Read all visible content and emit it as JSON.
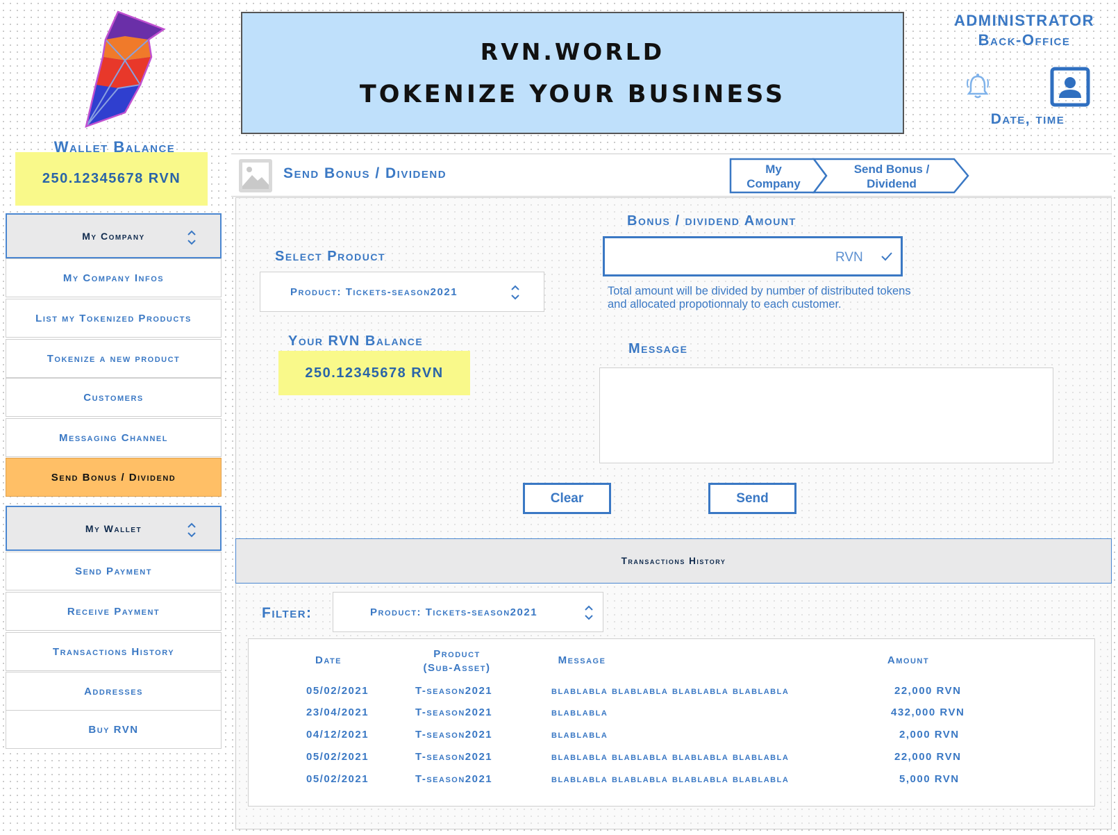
{
  "header": {
    "title_line1": "RVN.WORLD",
    "title_line2": "TOKENIZE YOUR BUSINESS",
    "admin_line1": "ADMINISTRATOR",
    "admin_line2": "Back-Office",
    "date_time": "Date, time",
    "icons": {
      "bell": "bell-icon",
      "avatar": "user-profile-icon"
    }
  },
  "wallet": {
    "label": "Wallet Balance",
    "balance": "250.12345678 RVN"
  },
  "sidebar": {
    "company_group": "My Company",
    "company_items": [
      "My Company Infos",
      "List my Tokenized Products",
      "Tokenize a new product",
      "Customers",
      "Messaging Channel",
      "Send Bonus / Dividend"
    ],
    "active_item": "Send Bonus / Dividend",
    "wallet_group": "My Wallet",
    "wallet_items": [
      "Send Payment",
      "Receive Payment",
      "Transactions History",
      "Addresses",
      "Buy RVN"
    ]
  },
  "page": {
    "title": "Send Bonus / Dividend",
    "breadcrumb": [
      "My Company",
      "Send Bonus / Dividend"
    ]
  },
  "form": {
    "amount_label": "Bonus / dividend Amount",
    "amount_value": "",
    "amount_unit": "RVN",
    "amount_help": "Total amount will be divided by number of distributed tokens and allocated propotionnaly to each customer.",
    "product_label": "Select Product",
    "product_value": "Product: Tickets-season2021",
    "rvn_balance_label": "Your RVN Balance",
    "rvn_balance_value": "250.12345678 RVN",
    "message_label": "Message",
    "message_value": "",
    "clear_label": "Clear",
    "send_label": "Send"
  },
  "history": {
    "header": "Transactions History",
    "filter_label": "Filter:",
    "filter_value": "Product: Tickets-season2021",
    "columns": [
      "Date",
      "Product\n(Sub-Asset)",
      "Message",
      "Amount"
    ],
    "rows": [
      [
        "05/02/2021",
        "T-season2021",
        "blablabla blablabla blablabla blablabla",
        "22,000 RVN"
      ],
      [
        "23/04/2021",
        "T-season2021",
        "blablabla",
        "432,000 RVN"
      ],
      [
        "04/12/2021",
        "T-season2021",
        "blablabla",
        "2,000 RVN"
      ],
      [
        "05/02/2021",
        "T-season2021",
        "blablabla blablabla blablabla blablabla",
        "22,000 RVN"
      ],
      [
        "05/02/2021",
        "T-season2021",
        "blablabla blablabla blablabla blablabla",
        "5,000 RVN"
      ]
    ]
  },
  "colors": {
    "accent": "#3a78c4",
    "banner": "#bfe0fb",
    "highlight": "#f9f98a",
    "active_menu": "#ffbf66"
  }
}
